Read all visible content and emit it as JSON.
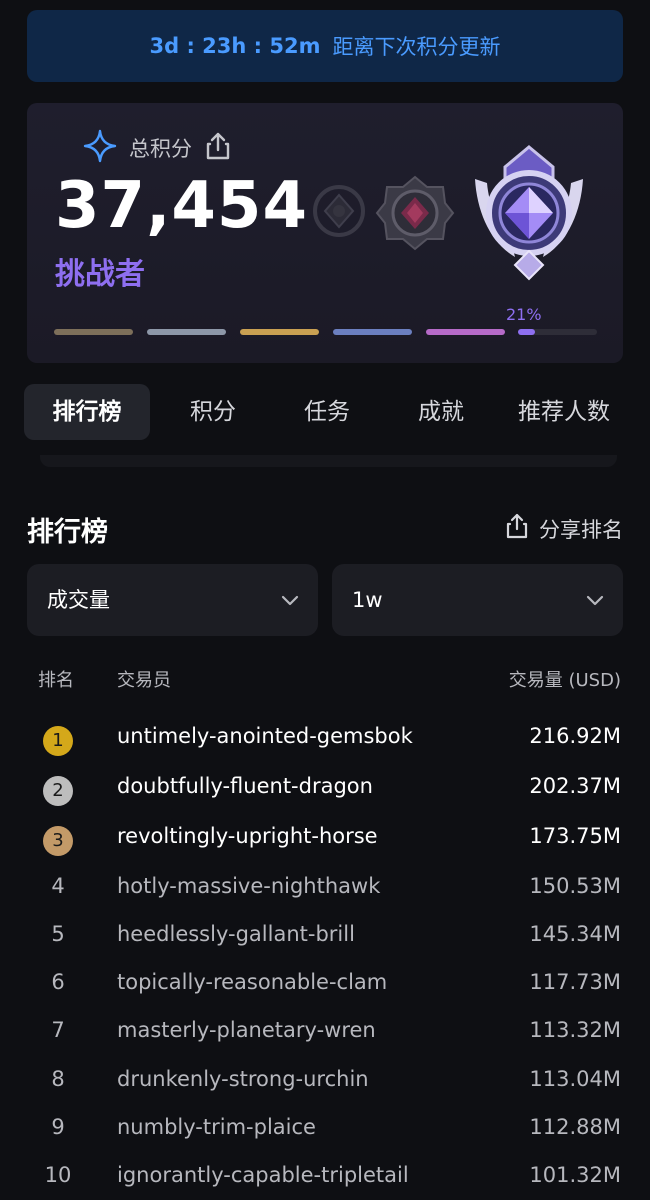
{
  "countdown": {
    "time": "3d : 23h : 52m",
    "label": "距离下次积分更新"
  },
  "score": {
    "label": "总积分",
    "value": "37,454",
    "rank_title": "挑战者",
    "progress_percent_label": "21%",
    "progress_fraction": 0.21
  },
  "colors": {
    "accent_purple": "#8e6ff0",
    "countdown_blue": "#4a9bff",
    "gold": "#d4a81a",
    "silver": "#bdbdbd",
    "bronze": "#c39a68"
  },
  "tabs": [
    {
      "label": "排行榜",
      "active": true
    },
    {
      "label": "积分",
      "active": false
    },
    {
      "label": "任务",
      "active": false
    },
    {
      "label": "成就",
      "active": false
    },
    {
      "label": "推荐人数",
      "active": false
    }
  ],
  "leaderboard": {
    "title": "排行榜",
    "share_label": "分享排名",
    "filters": {
      "metric": "成交量",
      "period": "1w"
    },
    "headers": {
      "rank": "排名",
      "trader": "交易员",
      "volume": "交易量 (USD)"
    },
    "rows": [
      {
        "rank": "1",
        "name": "untimely-anointed-gemsbok",
        "volume": "216.92M"
      },
      {
        "rank": "2",
        "name": "doubtfully-fluent-dragon",
        "volume": "202.37M"
      },
      {
        "rank": "3",
        "name": "revoltingly-upright-horse",
        "volume": "173.75M"
      },
      {
        "rank": "4",
        "name": "hotly-massive-nighthawk",
        "volume": "150.53M"
      },
      {
        "rank": "5",
        "name": "heedlessly-gallant-brill",
        "volume": "145.34M"
      },
      {
        "rank": "6",
        "name": "topically-reasonable-clam",
        "volume": "117.73M"
      },
      {
        "rank": "7",
        "name": "masterly-planetary-wren",
        "volume": "113.32M"
      },
      {
        "rank": "8",
        "name": "drunkenly-strong-urchin",
        "volume": "113.04M"
      },
      {
        "rank": "9",
        "name": "numbly-trim-plaice",
        "volume": "112.88M"
      },
      {
        "rank": "10",
        "name": "ignorantly-capable-tripletail",
        "volume": "101.32M"
      }
    ]
  },
  "icons": {
    "sparkle": "sparkle-icon",
    "share": "share-icon",
    "chevron": "chevron-down-icon"
  }
}
